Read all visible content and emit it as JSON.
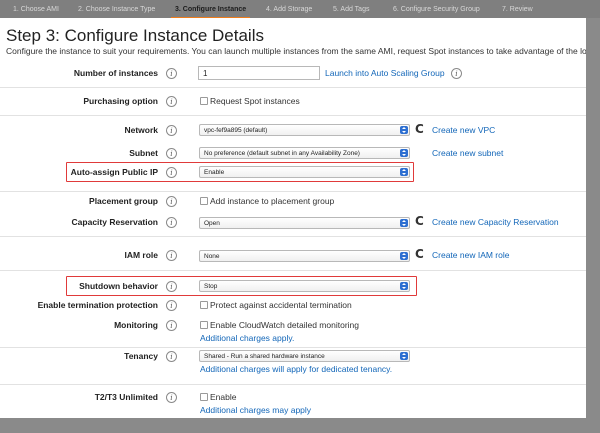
{
  "tabs": [
    {
      "label": "1. Choose AMI"
    },
    {
      "label": "2. Choose Instance Type"
    },
    {
      "label": "3. Configure Instance"
    },
    {
      "label": "4. Add Storage"
    },
    {
      "label": "5. Add Tags"
    },
    {
      "label": "6. Configure Security Group"
    },
    {
      "label": "7. Review"
    }
  ],
  "page": {
    "title": "Step 3: Configure Instance Details",
    "subtitle": "Configure the instance to suit your requirements. You can launch multiple instances from the same AMI, request Spot instances to take advantage of the lower"
  },
  "info_glyph": "i",
  "refresh_glyph": "C",
  "rows": {
    "num_instances": {
      "label": "Number of instances",
      "value": "1",
      "link": "Launch into Auto Scaling Group"
    },
    "purchasing": {
      "label": "Purchasing option",
      "option": "Request Spot instances"
    },
    "network": {
      "label": "Network",
      "value": "vpc-fef9a895 (default)",
      "link": "Create new VPC"
    },
    "subnet": {
      "label": "Subnet",
      "value": "No preference (default subnet in any Availability Zone)",
      "link": "Create new subnet"
    },
    "public_ip": {
      "label": "Auto-assign Public IP",
      "value": "Enable"
    },
    "placement": {
      "label": "Placement group",
      "option": "Add instance to placement group"
    },
    "capacity": {
      "label": "Capacity Reservation",
      "value": "Open",
      "link": "Create new Capacity Reservation"
    },
    "iam": {
      "label": "IAM role",
      "value": "None",
      "link": "Create new IAM role"
    },
    "shutdown": {
      "label": "Shutdown behavior",
      "value": "Stop"
    },
    "termination": {
      "label": "Enable termination protection",
      "option": "Protect against accidental termination"
    },
    "monitoring": {
      "label": "Monitoring",
      "option": "Enable CloudWatch detailed monitoring",
      "note": "Additional charges apply."
    },
    "tenancy": {
      "label": "Tenancy",
      "value": "Shared - Run a shared hardware instance",
      "note": "Additional charges will apply for dedicated tenancy."
    },
    "unlimited": {
      "label": "T2/T3 Unlimited",
      "option": "Enable",
      "note": "Additional charges may apply"
    }
  },
  "colors": {
    "highlight": "#e03a3a",
    "link": "#1266b8",
    "active_tab_underline": "#ef7d1b",
    "select_caret": "#2d6fd1"
  }
}
